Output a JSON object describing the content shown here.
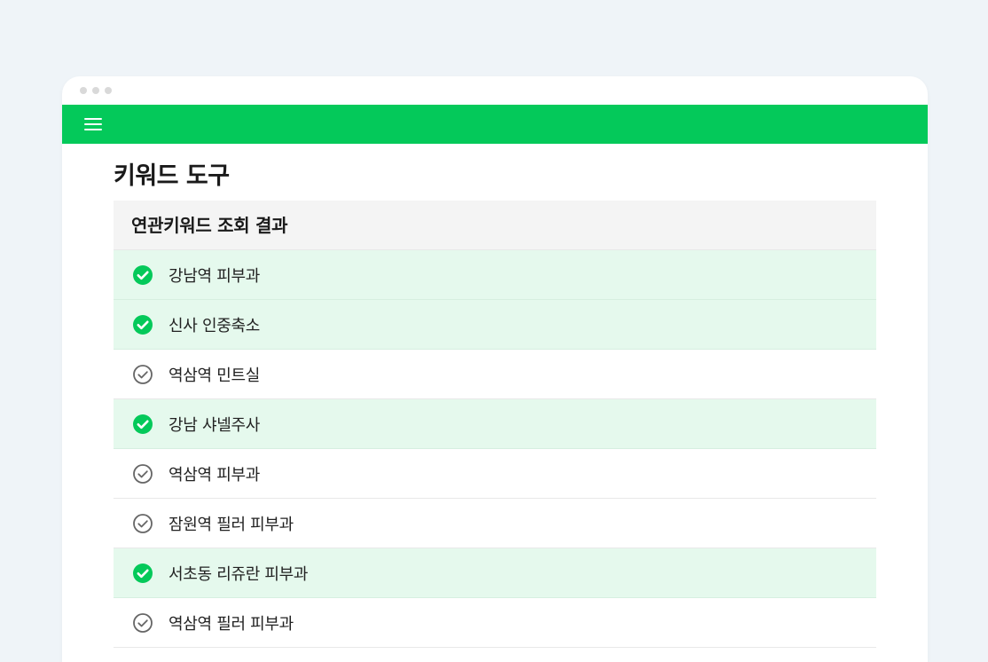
{
  "app": {
    "title": "키워드 도구"
  },
  "colors": {
    "accent": "#04c95a",
    "checked_row_bg": "#e5f9ed",
    "unchecked_icon": "#666666"
  },
  "panel": {
    "header": "연관키워드 조회 결과",
    "items": [
      {
        "label": "강남역 피부과",
        "checked": true
      },
      {
        "label": "신사 인중축소",
        "checked": true
      },
      {
        "label": "역삼역 민트실",
        "checked": false
      },
      {
        "label": "강남 샤넬주사",
        "checked": true
      },
      {
        "label": "역삼역 피부과",
        "checked": false
      },
      {
        "label": "잠원역 필러 피부과",
        "checked": false
      },
      {
        "label": "서초동 리쥬란 피부과",
        "checked": true
      },
      {
        "label": "역삼역 필러 피부과",
        "checked": false
      }
    ]
  }
}
